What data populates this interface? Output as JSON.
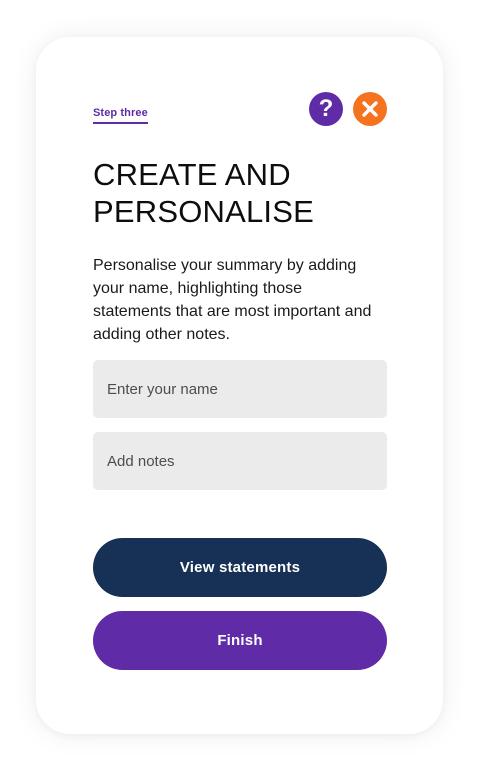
{
  "step": {
    "label": "Step three"
  },
  "header": {
    "help_glyph": "?",
    "help_icon": "question-mark-icon",
    "close_icon": "close-x-icon"
  },
  "title": "CREATE AND PERSONALISE",
  "description": "Personalise your summary by adding your name, highlighting those statements that are most important and adding other notes.",
  "form": {
    "name_placeholder": "Enter your name",
    "name_value": "",
    "notes_placeholder": "Add notes",
    "notes_value": ""
  },
  "actions": {
    "view_statements_label": "View statements",
    "finish_label": "Finish"
  },
  "colors": {
    "accent_purple": "#5f2ba6",
    "close_orange": "#f5731f",
    "navy_button": "#163155",
    "field_background": "#ebebeb"
  }
}
